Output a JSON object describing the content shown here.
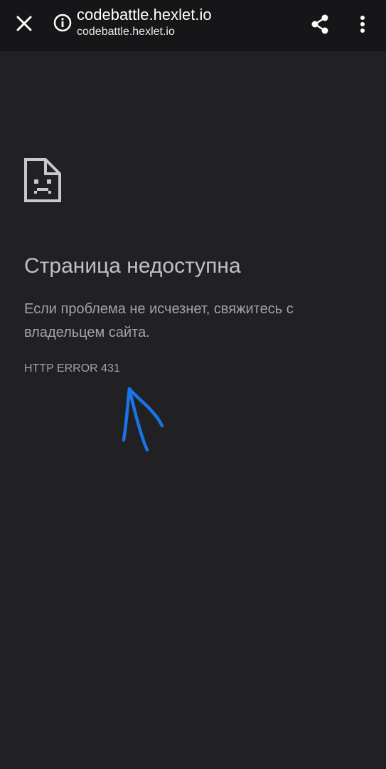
{
  "topbar": {
    "title": "codebattle.hexlet.io",
    "subtitle": "codebattle.hexlet.io",
    "close_icon": "close-icon",
    "info_icon": "info-icon",
    "share_icon": "share-icon",
    "menu_icon": "more-vert-icon"
  },
  "error_page": {
    "icon": "sad-document-icon",
    "title": "Страница недоступна",
    "description": "Если проблема не исчезнет, свяжитесь с владельцем сайта.",
    "code": "HTTP ERROR 431"
  },
  "colors": {
    "background": "#212124",
    "topbar": "#161618",
    "title_text": "#bdc1c6",
    "body_text": "#a0a4a9",
    "annotation": "#1a73e8"
  }
}
